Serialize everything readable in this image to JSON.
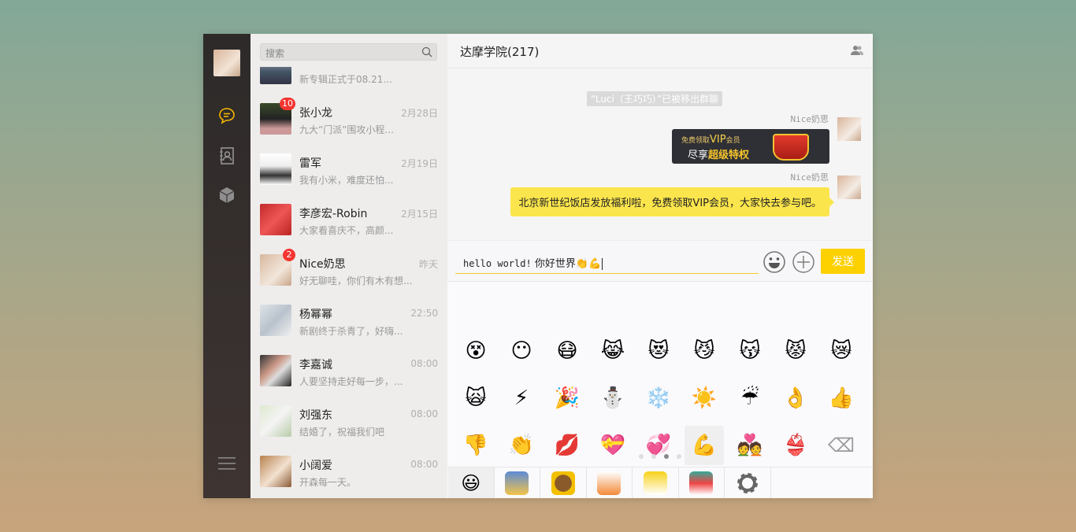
{
  "sidebar": {
    "nav": [
      "chat-icon",
      "contacts-icon",
      "apps-icon",
      "menu-icon"
    ],
    "active_color": "#f5b700"
  },
  "search": {
    "placeholder": "搜索"
  },
  "conversations": [
    {
      "name": "",
      "preview": "新专辑正式于08.21...",
      "time": "",
      "badge": ""
    },
    {
      "name": "张小龙",
      "preview": "九大“门派”围攻小程...",
      "time": "2月28日",
      "badge": "10"
    },
    {
      "name": "雷军",
      "preview": "我有小米，难度还怕...",
      "time": "2月19日",
      "badge": ""
    },
    {
      "name": "李彦宏-Robin",
      "preview": "大家看喜庆不，高颜...",
      "time": "2月15日",
      "badge": ""
    },
    {
      "name": "Nice奶思",
      "preview": "好无聊哇，你们有木有想...",
      "time": "昨天",
      "badge": "2"
    },
    {
      "name": "杨幂幂",
      "preview": "新剧终于杀青了，好嗨...",
      "time": "22:50",
      "badge": ""
    },
    {
      "name": "李嘉诚",
      "preview": "人要坚持走好每一步，...",
      "time": "08:00",
      "badge": ""
    },
    {
      "name": "刘强东",
      "preview": "结婚了，祝福我们吧",
      "time": "08:00",
      "badge": ""
    },
    {
      "name": "小阔爱",
      "preview": "开森每一天。",
      "time": "08:00",
      "badge": ""
    }
  ],
  "chat": {
    "title": "达摩学院(217)",
    "system_message": "“Luci（王巧巧）”已被移出群聊",
    "messages": [
      {
        "sender": "Nice奶思",
        "type": "image",
        "banner_line1a": "免费领取",
        "banner_line1b": "VIP",
        "banner_line1c": "会员",
        "banner_line2a": "尽享",
        "banner_line2b": "超级特权"
      },
      {
        "sender": "Nice奶思",
        "type": "text",
        "text": "北京新世纪饭店发放福利啦，免费领取VIP会员，大家快去参与吧。"
      }
    ]
  },
  "composer": {
    "text_latin": "hello world!",
    "text_cjk": " 你好世界👏💪",
    "send_label": "发送"
  },
  "emoji_panel": {
    "emojis": [
      "😵",
      "😶",
      "😷",
      "😹",
      "😻",
      "😼",
      "😽",
      "😾",
      "😿",
      "🙀",
      "⚡",
      "🎉",
      "⛄",
      "❄️",
      "☀️",
      "☔",
      "👌",
      "👍",
      "👎",
      "👏",
      "💋",
      "💝",
      "💞",
      "💪",
      "💑",
      "👙",
      "⌫"
    ],
    "selected_index": 23,
    "pages": 4,
    "current_page": 3,
    "tabs": [
      "😃",
      "sticker-1",
      "sticker-2",
      "sticker-3",
      "sticker-4",
      "sticker-5",
      "settings"
    ]
  }
}
